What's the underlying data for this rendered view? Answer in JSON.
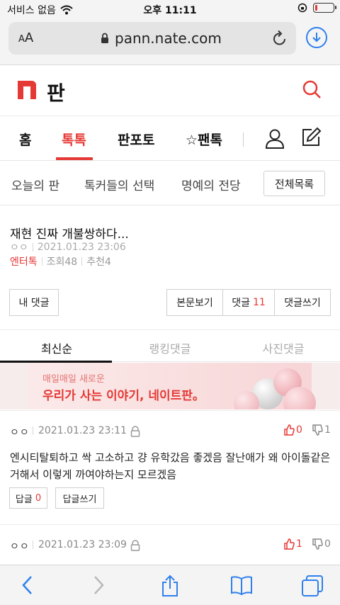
{
  "status_bar": {
    "carrier": "서비스 없음",
    "time": "오후 11:11"
  },
  "browser": {
    "text_size_label_small": "A",
    "text_size_label_large": "A",
    "url": "pann.nate.com"
  },
  "site": {
    "logo_text": "판"
  },
  "main_nav": {
    "tabs": [
      {
        "label": "홈"
      },
      {
        "label": "톡톡"
      },
      {
        "label": "판포토"
      },
      {
        "label": "☆팬톡"
      }
    ]
  },
  "sub_nav": {
    "items": [
      {
        "label": "오늘의 판"
      },
      {
        "label": "톡커들의 선택"
      },
      {
        "label": "명예의 전당"
      }
    ],
    "all_label": "전체목록"
  },
  "article": {
    "title": "재현 진짜 개불쌍하다...",
    "author": "ㅇㅇ",
    "date": "2021.01.23 23:06",
    "category": "엔터톡",
    "views": "조회48",
    "recommends": "추천4"
  },
  "actions": {
    "my_comments": "내 댓글",
    "view_body": "본문보기",
    "comments_label": "댓글",
    "comments_count": "11",
    "write_comment": "댓글쓰기"
  },
  "sort_tabs": [
    {
      "label": "최신순"
    },
    {
      "label": "랭킹댓글"
    },
    {
      "label": "사진댓글"
    }
  ],
  "banner": {
    "subtitle": "매일매일 새로운",
    "headline": "우리가 사는 이야기, 네이트판。"
  },
  "comments": [
    {
      "author": "ㅇㅇ",
      "date": "2021.01.23 23:11",
      "likes": "0",
      "dislikes": "1",
      "text": "엔시티탈퇴하고 싹 고소하고 걍 유학갔음 좋겠음 잘난애가 왜 아이돌같은거해서 이렇게 까여야하는지 모르겠음",
      "reply_label": "답글",
      "reply_count": "0",
      "write_reply": "답글쓰기"
    },
    {
      "author": "ㅇㅇ",
      "date": "2021.01.23 23:09",
      "likes": "1",
      "dislikes": "0"
    }
  ],
  "colors": {
    "accent": "#e53935",
    "link_blue": "#2f80ed"
  }
}
